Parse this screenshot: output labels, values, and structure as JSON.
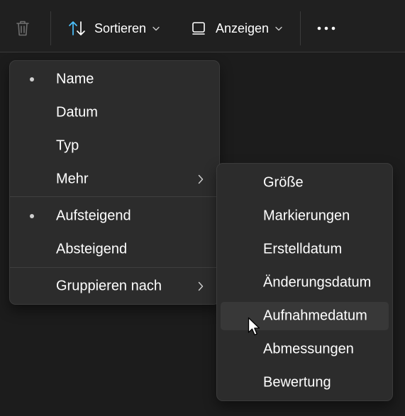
{
  "toolbar": {
    "delete_icon": "trash-icon",
    "sort_icon": "sort-arrows-icon",
    "sort_label": "Sortieren",
    "view_icon": "view-square-icon",
    "view_label": "Anzeigen",
    "more_icon": "ellipsis-icon",
    "accent_color": "#4cc2ff"
  },
  "sort_menu": {
    "items": [
      {
        "label": "Name",
        "selected": true
      },
      {
        "label": "Datum",
        "selected": false
      },
      {
        "label": "Typ",
        "selected": false
      },
      {
        "label": "Mehr",
        "has_submenu": true
      }
    ],
    "order_items": [
      {
        "label": "Aufsteigend",
        "selected": true
      },
      {
        "label": "Absteigend",
        "selected": false
      }
    ],
    "group_item": {
      "label": "Gruppieren nach",
      "has_submenu": true
    }
  },
  "more_submenu": {
    "items": [
      {
        "label": "Größe"
      },
      {
        "label": "Markierungen"
      },
      {
        "label": "Erstelldatum"
      },
      {
        "label": "Änderungsdatum"
      },
      {
        "label": "Aufnahmedatum",
        "hovered": true
      },
      {
        "label": "Abmessungen"
      },
      {
        "label": "Bewertung"
      }
    ]
  }
}
